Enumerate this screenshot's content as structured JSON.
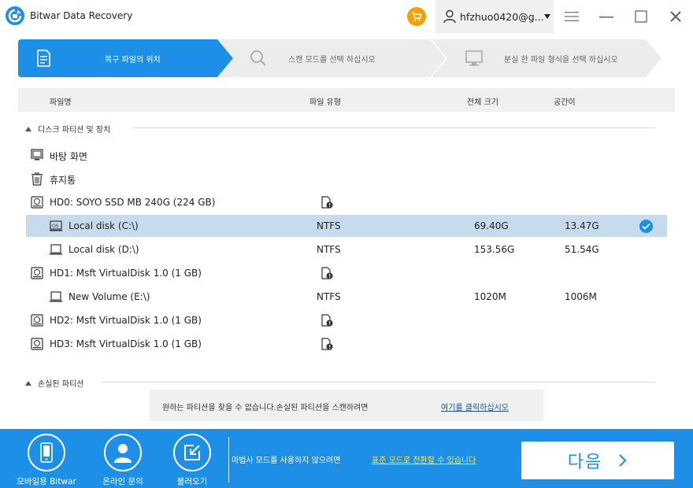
{
  "app": {
    "title": "Bitwar Data Recovery",
    "user_name": "hfzhuo0420@g...",
    "accent_color": "#1e8fe6",
    "cart_color": "#f5a000"
  },
  "steps": [
    {
      "label": "복구 파일의 위치",
      "icon": "document-icon",
      "active": true
    },
    {
      "label": "스캔 모드를 선택 하십시오",
      "icon": "search-icon",
      "active": false
    },
    {
      "label": "분실 한 파일 형식을 선택 하십시오",
      "icon": "monitor-icon",
      "active": false
    }
  ],
  "table_header": {
    "name": "파일명",
    "type": "파일 유형",
    "total_size": "전체 크기",
    "free_space": "공간이"
  },
  "sections": {
    "partitions": "디스크 파티션 및 장치",
    "lost": "손실된 파티션"
  },
  "items": {
    "desktop": {
      "name": "바탕 화면",
      "icon": "desktop-icon"
    },
    "recycle": {
      "name": "휴지통",
      "icon": "trash-icon"
    },
    "hd0": {
      "name": "HD0: SOYO SSD MB 240G (224 GB)",
      "icon": "hard-disk-icon"
    },
    "c": {
      "name": "Local disk (C:\\)",
      "fs": "NTFS",
      "size": "69.40G",
      "free": "13.47G",
      "icon": "os-drive-icon",
      "selected": true
    },
    "d": {
      "name": "Local disk (D:\\)",
      "fs": "NTFS",
      "size": "153.56G",
      "free": "51.54G",
      "icon": "drive-icon"
    },
    "hd1": {
      "name": "HD1: Msft VirtualDisk 1.0 (1 GB)",
      "icon": "hard-disk-icon"
    },
    "e": {
      "name": "New Volume (E:\\)",
      "fs": "NTFS",
      "size": "1020M",
      "free": "1006M",
      "icon": "drive-icon"
    },
    "hd2": {
      "name": "HD2: Msft VirtualDisk 1.0 (1 GB)",
      "icon": "hard-disk-icon"
    },
    "hd3": {
      "name": "HD3: Msft VirtualDisk 1.0 (1 GB)",
      "icon": "hard-disk-icon"
    }
  },
  "lost_partition": {
    "message": "원하는 파티션을 찾을 수 없습니다.손실된 파티션을 스캔하려면",
    "link": "여기를 클릭하십시오"
  },
  "footer": {
    "mobile_label": "모바일용 Bitwar",
    "support_label": "온라인 문의",
    "load_label": "불러오기",
    "wizard_text": "마법사 모드를 사용하지 않으려면",
    "standard_link": "표준 모드로 전환할 수 있습니다",
    "next_label": "다음"
  }
}
